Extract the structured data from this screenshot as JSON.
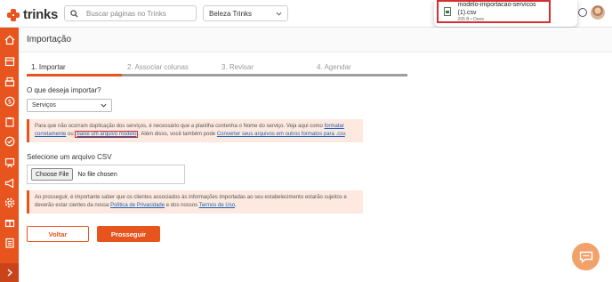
{
  "brand": {
    "name": "trinks",
    "accent": "#e8541e"
  },
  "topbar": {
    "search_placeholder": "Buscar páginas no Trinks",
    "salon_select": "Beleza Trinks"
  },
  "download": {
    "filename": "modelo-importacao-servicos (1).csv",
    "meta": "205 B • Done"
  },
  "page": {
    "title": "Importação"
  },
  "steps": [
    {
      "label": "1. Importar"
    },
    {
      "label": "2. Associar colunas"
    },
    {
      "label": "3. Revisar"
    },
    {
      "label": "4. Agendar"
    }
  ],
  "import": {
    "question": "O que deseja importar?",
    "selected": "Serviços"
  },
  "alert1": {
    "text_a": "Para que não ocorram duplicação dos serviços, é necessário que a planilha contenha o Nome do serviço. Veja aqui como ",
    "link_a": "formatar corretamente",
    "text_b": " ou ",
    "link_b": "baixe um arquivo modelo",
    "text_c": ". Além disso, você também pode ",
    "link_c": "Converter seus arquivos em outros formatos para .csv",
    "text_d": "."
  },
  "csv": {
    "label": "Selecione um arquivo CSV",
    "button": "Choose File",
    "status": "No file chosen"
  },
  "alert2": {
    "text_a": "Ao prosseguir, é importante saber que os clientes associados às informações importadas ao seu estabelecimento estarão sujeitos e deverão estar cientes da nossa ",
    "link_a": "Política de Privacidade",
    "text_b": " e dos nossos ",
    "link_b": "Termos de Uso",
    "text_c": "."
  },
  "actions": {
    "back": "Voltar",
    "next": "Prosseguir"
  },
  "icons": {
    "sidebar": [
      "home-icon",
      "store-icon",
      "register-icon",
      "money-icon",
      "clipboard-icon",
      "check-icon",
      "presentation-icon",
      "megaphone-icon",
      "gear-icon",
      "gift-icon",
      "report-icon"
    ],
    "expand": "chevron-right-icon"
  }
}
